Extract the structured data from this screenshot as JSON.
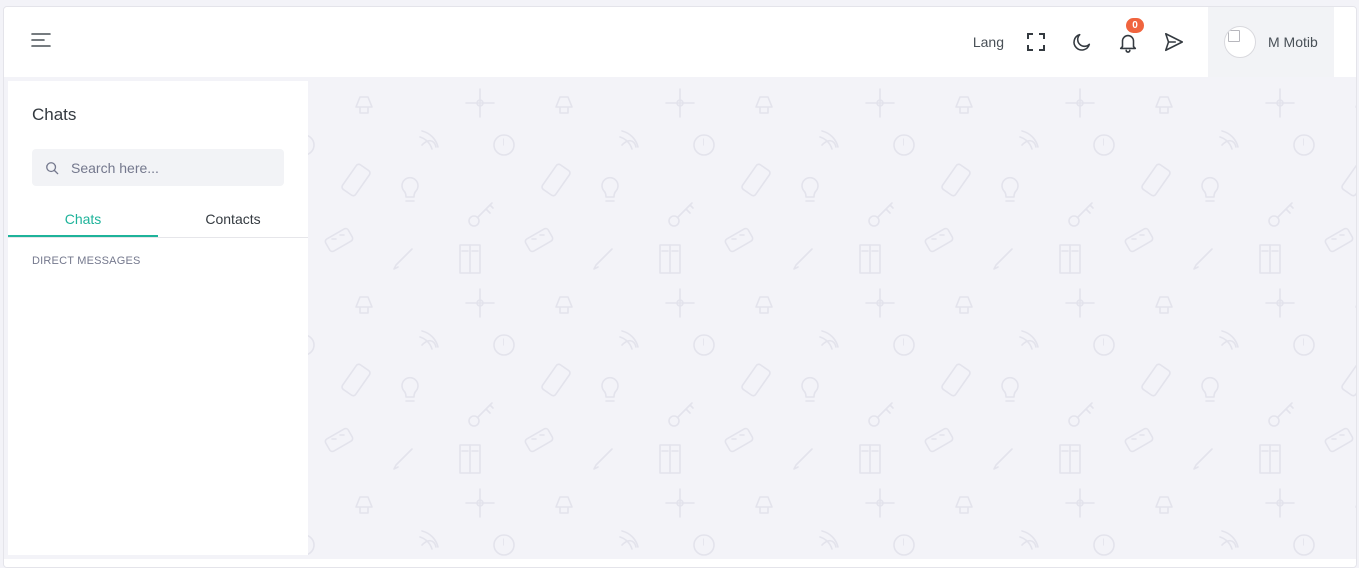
{
  "topbar": {
    "menu_icon": "hamburger-menu-icon",
    "lang_label": "Lang",
    "fullscreen_icon": "fullscreen-icon",
    "theme_icon": "moon-icon",
    "notification_icon": "bell-icon",
    "notification_count": "0",
    "send_icon": "send-icon",
    "user_name": "M Motib"
  },
  "sidebar": {
    "title": "Chats",
    "search_placeholder": "Search here...",
    "tabs": [
      {
        "label": "Chats",
        "active": true
      },
      {
        "label": "Contacts",
        "active": false
      }
    ],
    "section_label": "DIRECT MESSAGES"
  },
  "colors": {
    "accent": "#1eb39a",
    "badge": "#f0643e",
    "background": "#f3f3f8",
    "pattern": "#e3e3ec"
  }
}
